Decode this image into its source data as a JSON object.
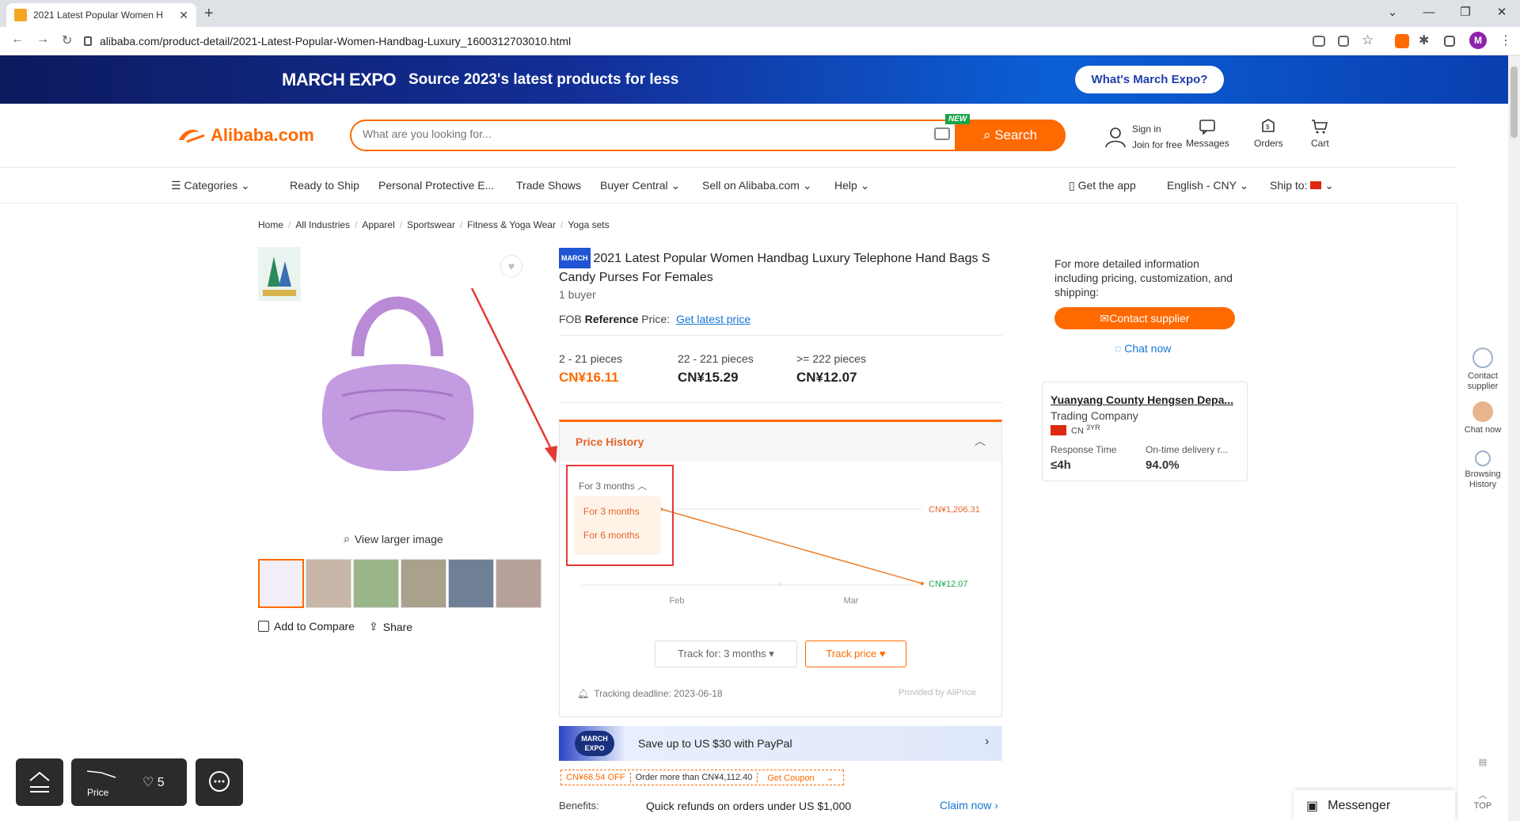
{
  "browser": {
    "tab_title": "2021 Latest Popular Women H",
    "url": "alibaba.com/product-detail/2021-Latest-Popular-Women-Handbag-Luxury_1600312703010.html",
    "profile_initial": "M"
  },
  "banner": {
    "brand": "MARCH EXPO",
    "tagline": "Source 2023's latest products for less",
    "cta": "What's March Expo?"
  },
  "header": {
    "logo": "Alibaba.com",
    "search_placeholder": "What are you looking for...",
    "new_badge": "NEW",
    "search_button": "Search",
    "sign_in": "Sign in",
    "join": "Join for free",
    "messages": "Messages",
    "orders": "Orders",
    "cart": "Cart"
  },
  "nav": {
    "categories": "Categories",
    "ready_to_ship": "Ready to Ship",
    "ppe": "Personal Protective E...",
    "trade_shows": "Trade Shows",
    "buyer_central": "Buyer Central",
    "sell": "Sell on Alibaba.com",
    "help": "Help",
    "get_app": "Get the app",
    "language": "English - CNY",
    "ship_to": "Ship to:"
  },
  "breadcrumb": [
    "Home",
    "All Industries",
    "Apparel",
    "Sportswear",
    "Fitness & Yoga Wear",
    "Yoga sets"
  ],
  "gallery": {
    "view_larger": "View larger image",
    "add_compare": "Add to Compare",
    "share": "Share"
  },
  "product": {
    "tag": "MARCH",
    "title": "2021 Latest Popular Women Handbag Luxury Telephone Hand Bags S Candy Purses For Females",
    "buyers": "1 buyer",
    "fob_prefix": "FOB",
    "fob_ref": "Reference",
    "fob_price": "Price:",
    "fob_link": "Get latest price",
    "tiers": [
      {
        "qty": "2 - 21 pieces",
        "price": "CN¥16.11"
      },
      {
        "qty": "22 - 221 pieces",
        "price": "CN¥15.29"
      },
      {
        "qty": ">= 222 pieces",
        "price": "CN¥12.07"
      }
    ]
  },
  "price_history": {
    "title": "Price History",
    "period_selected": "For 3 months",
    "options": [
      "For 3 months",
      "For 6 months"
    ],
    "track_for": "Track for: 3 months",
    "track_price": "Track price",
    "deadline": "Tracking deadline: 2023-06-18",
    "provided_by": "Provided by AliPrice"
  },
  "chart_data": {
    "type": "line",
    "x": [
      "Feb",
      "Mar"
    ],
    "series": [
      {
        "values": [
          1206.31,
          12.07
        ]
      }
    ],
    "labels": {
      "high": "CN¥1,206.31",
      "low": "CN¥12.07"
    },
    "xticks": [
      "Feb",
      "Mar"
    ],
    "colors": {
      "line": "#f07c24",
      "high": "#e8642c",
      "low": "#19a84b"
    }
  },
  "promo": {
    "badge": "MARCH EXPO",
    "paypal": "Save up to US $30 with PayPal",
    "coupon_off": "CN¥68.54 OFF",
    "coupon_condition": "Order more than CN¥4,112.40",
    "coupon_get": "Get Coupon",
    "benefits_label": "Benefits:",
    "benefits_text": "Quick refunds on orders under US $1,000",
    "claim": "Claim now"
  },
  "contact": {
    "info": "For more detailed information including pricing, customization, and shipping:",
    "contact_button": "Contact supplier",
    "chat_now": "Chat now"
  },
  "supplier": {
    "name": "Yuanyang County Hengsen Depa...",
    "type": "Trading Company",
    "country": "CN",
    "years": "3YR",
    "response_label": "Response Time",
    "response_value": "≤4h",
    "ontime_label": "On-time delivery r...",
    "ontime_value": "94.0%"
  },
  "rail": {
    "contact": "Contact supplier",
    "chat": "Chat now",
    "history": "Browsing History",
    "top": "TOP"
  },
  "messenger": "Messenger",
  "widgets": {
    "price": "Price",
    "fav_count": "5"
  },
  "colors": {
    "accent": "#ff6a00",
    "link": "#1677d2",
    "highlight_box": "#e53935"
  }
}
